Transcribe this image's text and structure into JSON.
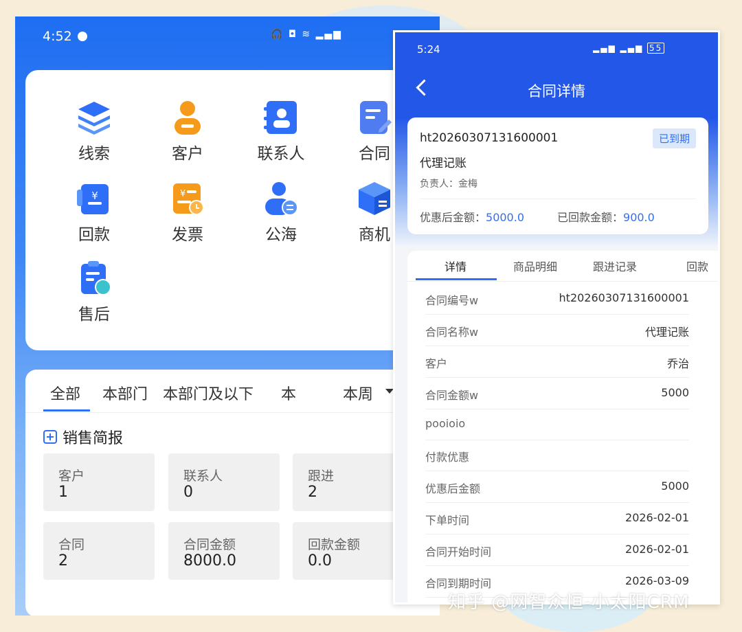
{
  "left": {
    "status_time": "4:52",
    "menu": [
      {
        "label": "线索",
        "icon": "layers-icon"
      },
      {
        "label": "客户",
        "icon": "person-icon"
      },
      {
        "label": "联系人",
        "icon": "contact-book-icon"
      },
      {
        "label": "合同",
        "icon": "contract-edit-icon"
      },
      {
        "label": "回款",
        "icon": "payment-receipt-icon"
      },
      {
        "label": "发票",
        "icon": "invoice-icon"
      },
      {
        "label": "公海",
        "icon": "user-exchange-icon"
      },
      {
        "label": "商机",
        "icon": "cube-box-icon"
      },
      {
        "label": "售后",
        "icon": "after-sales-icon"
      }
    ],
    "filter_tabs": [
      "全部",
      "本部门",
      "本部门及以下",
      "本"
    ],
    "period": "本周",
    "report_title": "销售简报",
    "stats": [
      {
        "label": "客户",
        "value": "1"
      },
      {
        "label": "联系人",
        "value": "0"
      },
      {
        "label": "跟进",
        "value": "2"
      },
      {
        "label": "合同",
        "value": "2"
      },
      {
        "label": "合同金额",
        "value": "8000.0"
      },
      {
        "label": "回款金额",
        "value": "0.0"
      }
    ],
    "colors": {
      "primary": "#2f6ef6",
      "icon_blue": "#2f6ef6",
      "icon_orange": "#f59a1b"
    }
  },
  "right": {
    "status_time": "5:24",
    "battery": "55",
    "title": "合同详情",
    "summary": {
      "code": "ht20260307131600001",
      "badge": "已到期",
      "name": "代理记账",
      "owner": "负责人：金梅",
      "discount_label": "优惠后金额：",
      "discount_value": "5000.0",
      "paid_label": "已回款金额：",
      "paid_value": "900.0"
    },
    "tabs": [
      "详情",
      "商品明细",
      "跟进记录",
      "回款"
    ],
    "rows": [
      {
        "key": "合同编号w",
        "value": "ht20260307131600001"
      },
      {
        "key": "合同名称w",
        "value": "代理记账"
      },
      {
        "key": "客户",
        "value": "乔治"
      },
      {
        "key": "合同金额w",
        "value": "5000"
      },
      {
        "key": "pooioio",
        "value": ""
      },
      {
        "key": "付款优惠",
        "value": ""
      },
      {
        "key": "优惠后金额",
        "value": "5000"
      },
      {
        "key": "下单时间",
        "value": "2026-02-01"
      },
      {
        "key": "合同开始时间",
        "value": "2026-02-01"
      },
      {
        "key": "合同到期时间",
        "value": "2026-03-09"
      }
    ]
  },
  "watermark": "知乎 @网智众恒-小太阳CRM"
}
